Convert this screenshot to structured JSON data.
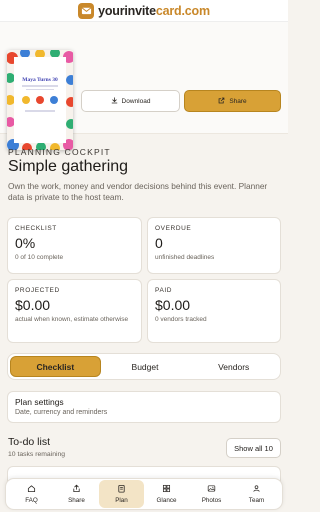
{
  "brand": {
    "part1": "yourinvite",
    "part2": "card.com"
  },
  "invite": {
    "title": "Maya Turns 30"
  },
  "actions": {
    "download": "Download",
    "share": "Share"
  },
  "header": {
    "eyebrow": "PLANNING COCKPIT",
    "title": "Simple gathering",
    "subtitle": "Own the work, money and vendor decisions behind this event. Planner data is private to the host team."
  },
  "stats": [
    {
      "label": "CHECKLIST",
      "value": "0%",
      "note": "0 of 10 complete"
    },
    {
      "label": "OVERDUE",
      "value": "0",
      "note": "unfinished deadlines"
    },
    {
      "label": "PROJECTED",
      "value": "$0.00",
      "note": "actual when known, estimate otherwise"
    },
    {
      "label": "PAID",
      "value": "$0.00",
      "note": "0 vendors tracked"
    }
  ],
  "tabs": [
    "Checklist",
    "Budget",
    "Vendors"
  ],
  "plan_settings": {
    "title": "Plan settings",
    "subtitle": "Date, currency and reminders"
  },
  "todo": {
    "title": "To-do list",
    "subtitle": "10 tasks remaining",
    "show_all": "Show all 10"
  },
  "nav": [
    {
      "label": "FAQ",
      "icon": "home-icon"
    },
    {
      "label": "Share",
      "icon": "share-icon"
    },
    {
      "label": "Plan",
      "icon": "clipboard-icon",
      "active": true
    },
    {
      "label": "Glance",
      "icon": "grid-icon"
    },
    {
      "label": "Photos",
      "icon": "image-icon"
    },
    {
      "label": "Team",
      "icon": "team-icon"
    }
  ],
  "colors": {
    "accent": "#d8a136",
    "background": "#f6f3ee"
  }
}
